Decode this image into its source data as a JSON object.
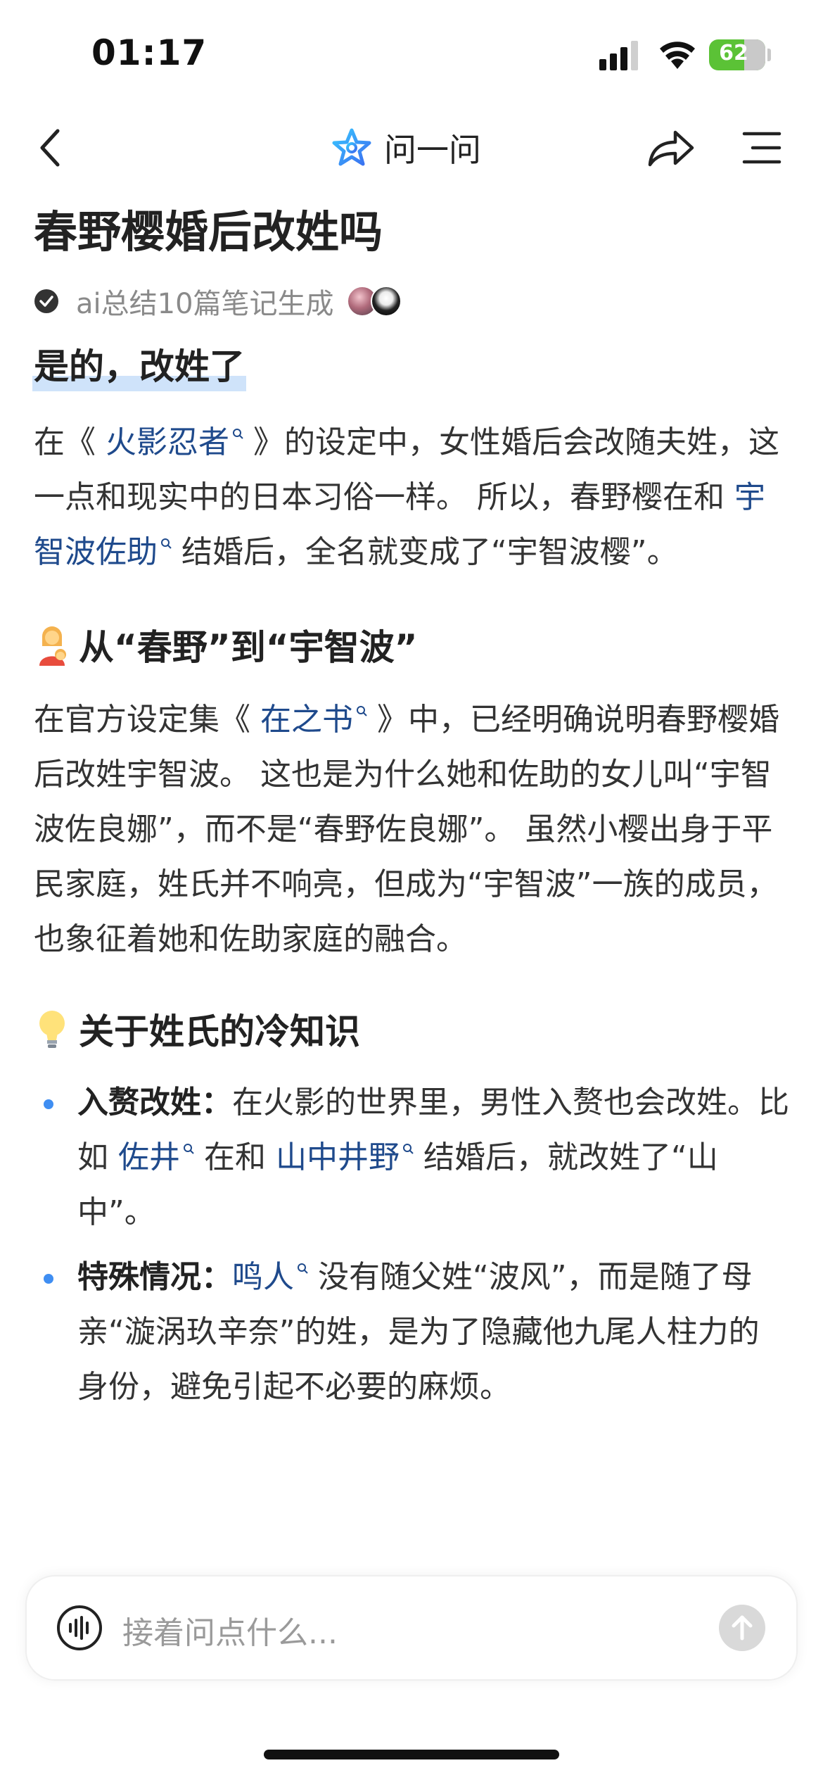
{
  "status_bar": {
    "time": "01:17",
    "battery_level": "62"
  },
  "nav": {
    "title": "问一问"
  },
  "page": {
    "title": "春野樱婚后改姓吗",
    "meta_text": "ai总结10篇笔记生成",
    "answer": "是的，改姓了",
    "p1": {
      "t1": "在《 ",
      "link1": "火影忍者",
      "t2": " 》的设定中，女性婚后会改随夫姓，这一点和现实中的日本习俗一样。 所以，春野樱在和 ",
      "link2": "宇智波佐助",
      "t3": " 结婚后，全名就变成了“宇智波樱”。"
    },
    "section1": {
      "heading": "从“春野”到“宇智波”",
      "t1": "在官方设定集《 ",
      "link1": "在之书",
      "t2": " 》中，已经明确说明春野樱婚后改姓宇智波。 这也是为什么她和佐助的女儿叫“宇智波佐良娜”，而不是“春野佐良娜”。 虽然小樱出身于平民家庭，姓氏并不响亮，但成为“宇智波”一族的成员，也象征着她和佐助家庭的融合。"
    },
    "section2": {
      "heading": "关于姓氏的冷知识",
      "bullets": [
        {
          "title": "入赘改姓：",
          "t1": "在火影的世界里，男性入赘也会改姓。比如 ",
          "link1": "佐井",
          "t2": " 在和 ",
          "link2": "山中井野",
          "t3": " 结婚后，就改姓了“山中”。"
        },
        {
          "title": "特殊情况：",
          "link1": "鸣人",
          "t1": " 没有随父姓“波风”，而是随了母亲“漩涡玖辛奈”的姓，是为了隐藏他九尾人柱力的身份，避免引起不必要的麻烦。"
        }
      ]
    }
  },
  "input": {
    "placeholder": "接着问点什么..."
  },
  "colors": {
    "link": "#1f4a8c",
    "accent": "#3f8ef2",
    "highlight": "#cfe3fa",
    "battery": "#5bc236"
  },
  "icons": [
    "back-icon",
    "star-icon",
    "share-icon",
    "menu-icon",
    "check-icon",
    "woman-emoji-icon",
    "lightbulb-emoji-icon",
    "search-small-icon",
    "voice-icon",
    "send-arrow-icon"
  ]
}
